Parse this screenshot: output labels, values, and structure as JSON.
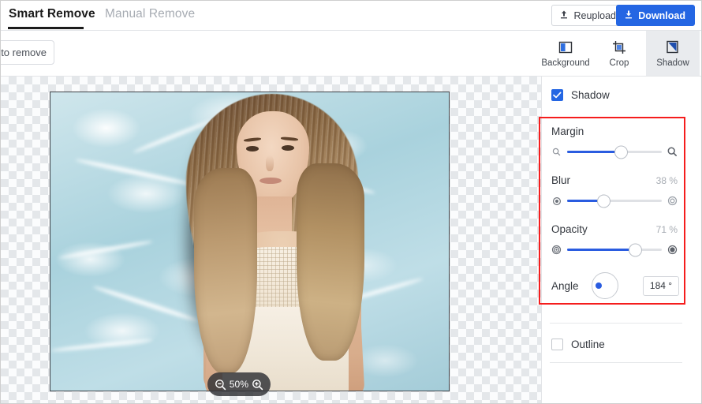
{
  "tabs": [
    {
      "label": "Smart Remove",
      "active": true
    },
    {
      "label": "Manual Remove",
      "active": false
    }
  ],
  "header": {
    "reupload_label": "Reupload",
    "download_label": "Download",
    "reupload_icon": "upload-icon",
    "download_icon": "download-icon",
    "download_color": "#2466e3"
  },
  "subbar": {
    "to_remove_label": "to remove"
  },
  "tools": [
    {
      "label": "Background",
      "icon": "background-icon",
      "active": false
    },
    {
      "label": "Crop",
      "icon": "crop-icon",
      "active": false
    },
    {
      "label": "Shadow",
      "icon": "shadow-icon",
      "active": true
    }
  ],
  "canvas": {
    "zoom_level": "50%",
    "zoom_out_icon": "zoom-out-icon",
    "zoom_in_icon": "zoom-in-icon"
  },
  "panel": {
    "shadow": {
      "label": "Shadow",
      "checked": true
    },
    "highlight_color": "#f51d1d",
    "fields": [
      {
        "label": "Margin",
        "value": "",
        "percent": 56,
        "left_icon": "zoom-small-icon",
        "right_icon": "zoom-large-icon"
      },
      {
        "label": "Blur",
        "value": "38 %",
        "percent": 38,
        "left_icon": "blur-small-icon",
        "right_icon": "blur-large-icon"
      },
      {
        "label": "Opacity",
        "value": "71 %",
        "percent": 71,
        "left_icon": "opacity-low-icon",
        "right_icon": "opacity-high-icon"
      }
    ],
    "angle": {
      "label": "Angle",
      "value": "184 °",
      "degrees": 184
    },
    "outline": {
      "label": "Outline",
      "checked": false
    }
  }
}
